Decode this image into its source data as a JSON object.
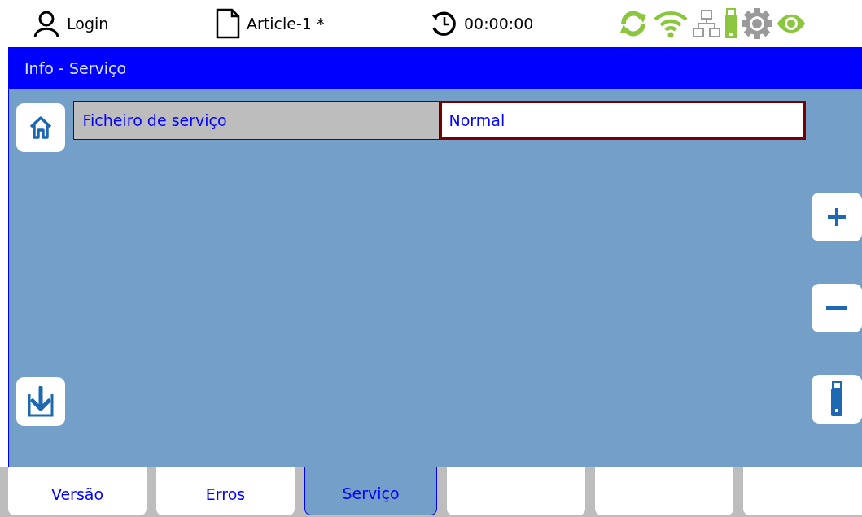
{
  "top_bar": {
    "user": "Login",
    "article": "Article-1 *",
    "timer": "00:00:00"
  },
  "title_bar": {
    "title": "Info - Serviço"
  },
  "field": {
    "label": "Ficheiro de serviço",
    "value": "Normal"
  },
  "tabs": [
    {
      "label": "Versão",
      "selected": false
    },
    {
      "label": "Erros",
      "selected": false
    },
    {
      "label": "Serviço",
      "selected": true
    },
    {
      "selected": false
    },
    {
      "selected": false
    },
    {
      "selected": false
    }
  ]
}
